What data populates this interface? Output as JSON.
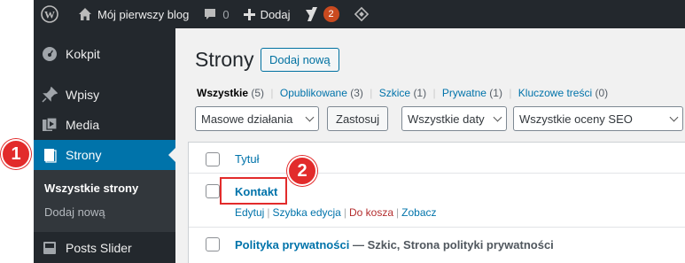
{
  "adminbar": {
    "site_name": "Mój pierwszy blog",
    "comments_count": "0",
    "add_new": "Dodaj",
    "yoast_badge": "2"
  },
  "sidebar": {
    "items": [
      {
        "label": "Kokpit",
        "icon": "dashboard-icon"
      },
      {
        "label": "Wpisy",
        "icon": "pin-icon"
      },
      {
        "label": "Media",
        "icon": "media-icon"
      },
      {
        "label": "Strony",
        "icon": "pages-icon"
      },
      {
        "label": "Posts Slider",
        "icon": "slider-icon"
      }
    ],
    "submenu": [
      {
        "label": "Wszystkie strony"
      },
      {
        "label": "Dodaj nową"
      }
    ]
  },
  "main": {
    "title": "Strony",
    "add_new_button": "Dodaj nową",
    "filters": [
      {
        "label": "Wszystkie",
        "count": "(5)"
      },
      {
        "label": "Opublikowane",
        "count": "(3)"
      },
      {
        "label": "Szkice",
        "count": "(1)"
      },
      {
        "label": "Prywatne",
        "count": "(1)"
      },
      {
        "label": "Kluczowe treści",
        "count": "(0)"
      }
    ],
    "bulk_actions": "Masowe działania",
    "apply_button": "Zastosuj",
    "dates_filter": "Wszystkie daty",
    "seo_filter": "Wszystkie oceny SEO",
    "table": {
      "column_title": "Tytuł",
      "rows": [
        {
          "title": "Kontakt",
          "state": "",
          "actions": [
            "Edytuj",
            "Szybka edycja",
            "Do kosza",
            "Zobacz"
          ]
        },
        {
          "title": "Polityka prywatności",
          "state": "— Szkic, Strona polityki prywatności",
          "actions": []
        }
      ]
    }
  },
  "annotations": [
    {
      "label": "1"
    },
    {
      "label": "2"
    }
  ],
  "colors": {
    "admin_dark": "#23282d",
    "accent": "#0073aa",
    "annotation_red": "#e22b2b"
  }
}
